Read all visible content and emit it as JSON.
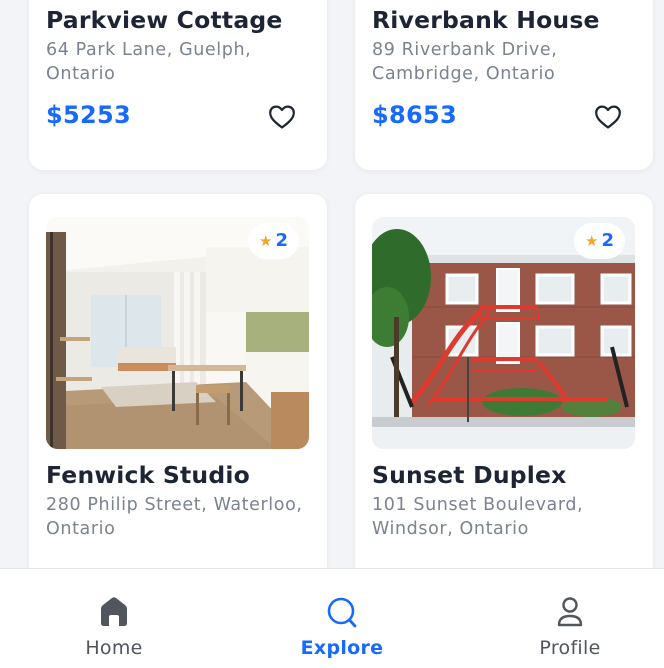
{
  "listings_top": [
    {
      "title": "Parkview Cottage",
      "address": "64 Park Lane, Guelph, Ontario",
      "price": "$5253"
    },
    {
      "title": "Riverbank House",
      "address": "89 Riverbank Drive, Cambridge, Ontario",
      "price": "$8653"
    }
  ],
  "listings_bottom": [
    {
      "title": "Fenwick Studio",
      "address": "280 Philip Street, Waterloo, Ontario",
      "rating": "2"
    },
    {
      "title": "Sunset Duplex",
      "address": "101 Sunset Boulevard, Windsor, Ontario",
      "rating": "2"
    }
  ],
  "nav": {
    "active": "Explore",
    "tabs": [
      {
        "label": "Home",
        "icon": "home-icon"
      },
      {
        "label": "Explore",
        "icon": "search-icon"
      },
      {
        "label": "Profile",
        "icon": "profile-icon"
      }
    ]
  },
  "colors": {
    "accent": "#1769ff",
    "heading": "#1d2433",
    "muted": "#7b8290",
    "star": "#f5a623"
  }
}
